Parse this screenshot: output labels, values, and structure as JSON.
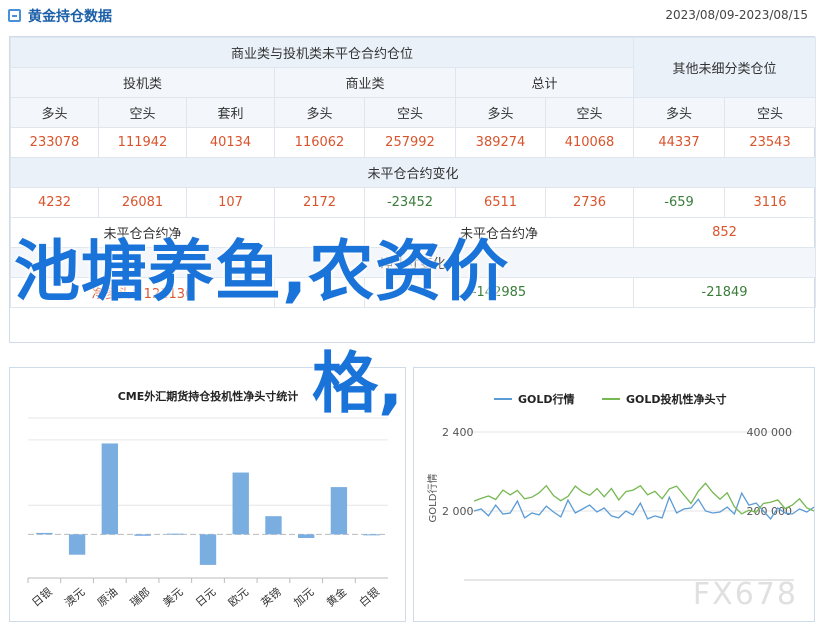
{
  "header": {
    "title": "黄金持仓数据",
    "date_range": "2023/08/09-2023/08/15"
  },
  "table": {
    "group_commercial": "商业类与投机类未平仓合约仓位",
    "group_other": "其他未细分类仓位",
    "speculative": "投机类",
    "commercial": "商业类",
    "total": "总计",
    "long": "多头",
    "short": "空头",
    "spread": "套利",
    "values": [
      "233078",
      "111942",
      "40134",
      "116062",
      "257992",
      "389274",
      "410068",
      "44337",
      "23543"
    ],
    "oi_change_title": "未平仓合约变化",
    "changes": [
      "4232",
      "26081",
      "107",
      "2172",
      "-23452",
      "6511",
      "2736",
      "-659",
      "3116"
    ],
    "spec_net_title": "未平仓合约净",
    "spec_net_value": "",
    "comm_net_title": "未平仓合约净",
    "comm_net_value": "852",
    "net_change_title": "净头寸变化",
    "spec_net_label": "净多头：121136",
    "comm_net_label": "-142985",
    "comm_net_prefix": "",
    "other_net_label": "-21849"
  },
  "overlay": {
    "line1": "池塘养鱼,农资价",
    "line2": "格,"
  },
  "watermark": "FX678",
  "left_chart_data": {
    "type": "bar",
    "title": "CME外汇期货持仓投机性净头寸统计",
    "categories": [
      "日银",
      "澳元",
      "原油",
      "瑞郎",
      "美元",
      "日元",
      "欧元",
      "英镑",
      "加元",
      "黄金",
      "白银"
    ],
    "values": [
      0.02,
      -0.28,
      1.25,
      -0.02,
      0.01,
      -0.42,
      0.85,
      0.25,
      -0.05,
      0.65,
      0
    ],
    "ylim": [
      -0.6,
      1.6
    ],
    "color": "#7aaee0"
  },
  "chart_data": {
    "type": "line",
    "series": [
      {
        "name": "GOLD行情",
        "color": "#5b9bd5",
        "values": [
          2000,
          2010,
          1975,
          2030,
          1985,
          1990,
          2050,
          1965,
          1990,
          1980,
          2025,
          1995,
          1970,
          2055,
          1990,
          2010,
          2030,
          1995,
          2015,
          1975,
          1965,
          2000,
          1980,
          2040,
          1960,
          1975,
          1965,
          2070,
          1990,
          2010,
          2015,
          2060,
          2000,
          1990,
          1995,
          2020,
          1985,
          2090,
          2030,
          2040,
          2000,
          1960,
          2015,
          1990,
          1985,
          2010,
          1995,
          2020
        ]
      },
      {
        "name": "GOLD投机性净头寸",
        "color": "#76b852",
        "values": [
          225000,
          232000,
          238000,
          229000,
          253000,
          241000,
          252000,
          231000,
          235000,
          246000,
          264000,
          239000,
          226000,
          237000,
          263000,
          248000,
          240000,
          257000,
          236000,
          257000,
          228000,
          249000,
          253000,
          264000,
          241000,
          250000,
          231000,
          256000,
          263000,
          241000,
          219000,
          250000,
          270000,
          247000,
          230000,
          246000,
          211000,
          193000,
          202000,
          197000,
          219000,
          222000,
          228000,
          206000,
          215000,
          231000,
          208000,
          200000
        ]
      }
    ],
    "ylabel": "GOLD行情",
    "y_ticks": [
      "2 400",
      "2 000"
    ],
    "y2_ticks": [
      "400 000",
      "200 000"
    ],
    "ylim": [
      1800,
      2400
    ],
    "y2lim": [
      0,
      400000
    ]
  }
}
